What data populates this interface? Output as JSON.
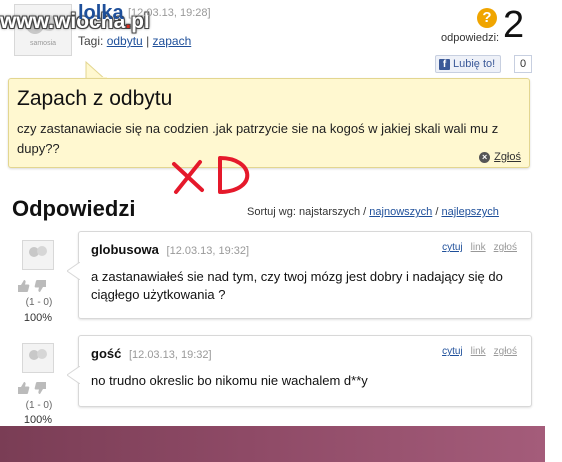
{
  "watermark": {
    "prefix": "www.",
    "brand": "wiocha",
    "dot": ".",
    "tld": "pl"
  },
  "question": {
    "username": "lolka",
    "date": "[12.03.13, 19:28]",
    "tags_label": "Tagi:",
    "tags": [
      "odbytu",
      "zapach"
    ],
    "tag_separator": "|",
    "answers_label": "odpowiedzi:",
    "answers_count": "2",
    "help_symbol": "?",
    "like_label": "Lubię to!",
    "like_count": "0",
    "title": "Zapach z odbytu",
    "body": "czy zastanawiacie się na codzien .jak patrzycie sie na kogoś w jakiej skali wali mu z dupy??",
    "report_label": "Zgłoś"
  },
  "scribble_text": "xD",
  "answers_section": {
    "heading": "Odpowiedzi",
    "sort_label": "Sortuj wg: najstarszych /",
    "sort_newest": "najnowszych",
    "sort_sep": "/",
    "sort_best": "najlepszych"
  },
  "answers": [
    {
      "author": "globusowa",
      "date": "[12.03.13, 19:32]",
      "text": "a zastanawiałeś sie nad tym, czy twoj mózg jest dobry i nadający się do ciągłego użytkowania ?",
      "vote_ratio": "(1 - 0)",
      "vote_percent": "100%",
      "actions": [
        "cytuj",
        "link",
        "zgłoś"
      ]
    },
    {
      "author": "gość",
      "date": "[12.03.13, 19:32]",
      "text": "no trudno okreslic bo nikomu nie wachalem d**y",
      "vote_ratio": "(1 - 0)",
      "vote_percent": "100%",
      "actions": [
        "cytuj",
        "link",
        "zgłoś"
      ]
    }
  ],
  "avatar_caption": "samosia"
}
